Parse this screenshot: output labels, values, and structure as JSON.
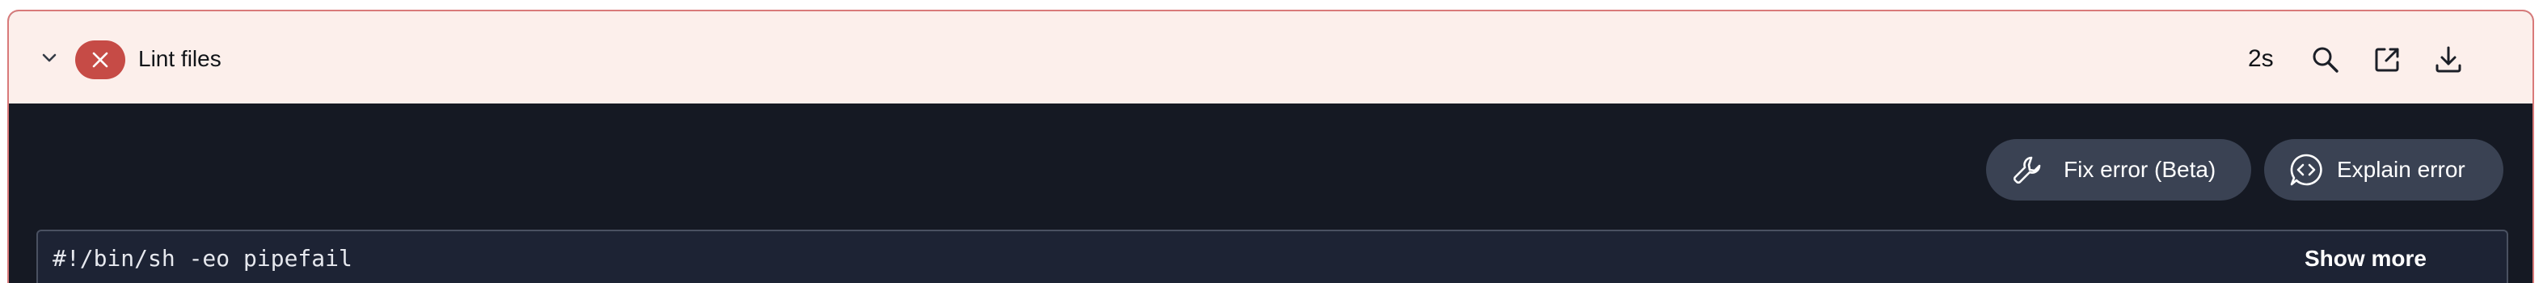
{
  "step": {
    "title": "Lint files",
    "status": "failed",
    "duration": "2s"
  },
  "header_actions": [
    {
      "name": "search",
      "icon": "search-icon"
    },
    {
      "name": "open-in-new",
      "icon": "external-link-icon"
    },
    {
      "name": "download",
      "icon": "download-icon"
    }
  ],
  "actions": {
    "fix_error_label": "Fix error (Beta)",
    "explain_error_label": "Explain error"
  },
  "log": {
    "first_line": "#!/bin/sh -eo pipefail",
    "show_more_label": "Show more"
  },
  "colors": {
    "header_bg": "#fcefeb",
    "border": "#d97a7a",
    "status_error": "#c64b46",
    "log_bg": "#151923",
    "code_bg": "#1d2334",
    "pill_bg": "#3a4253"
  }
}
